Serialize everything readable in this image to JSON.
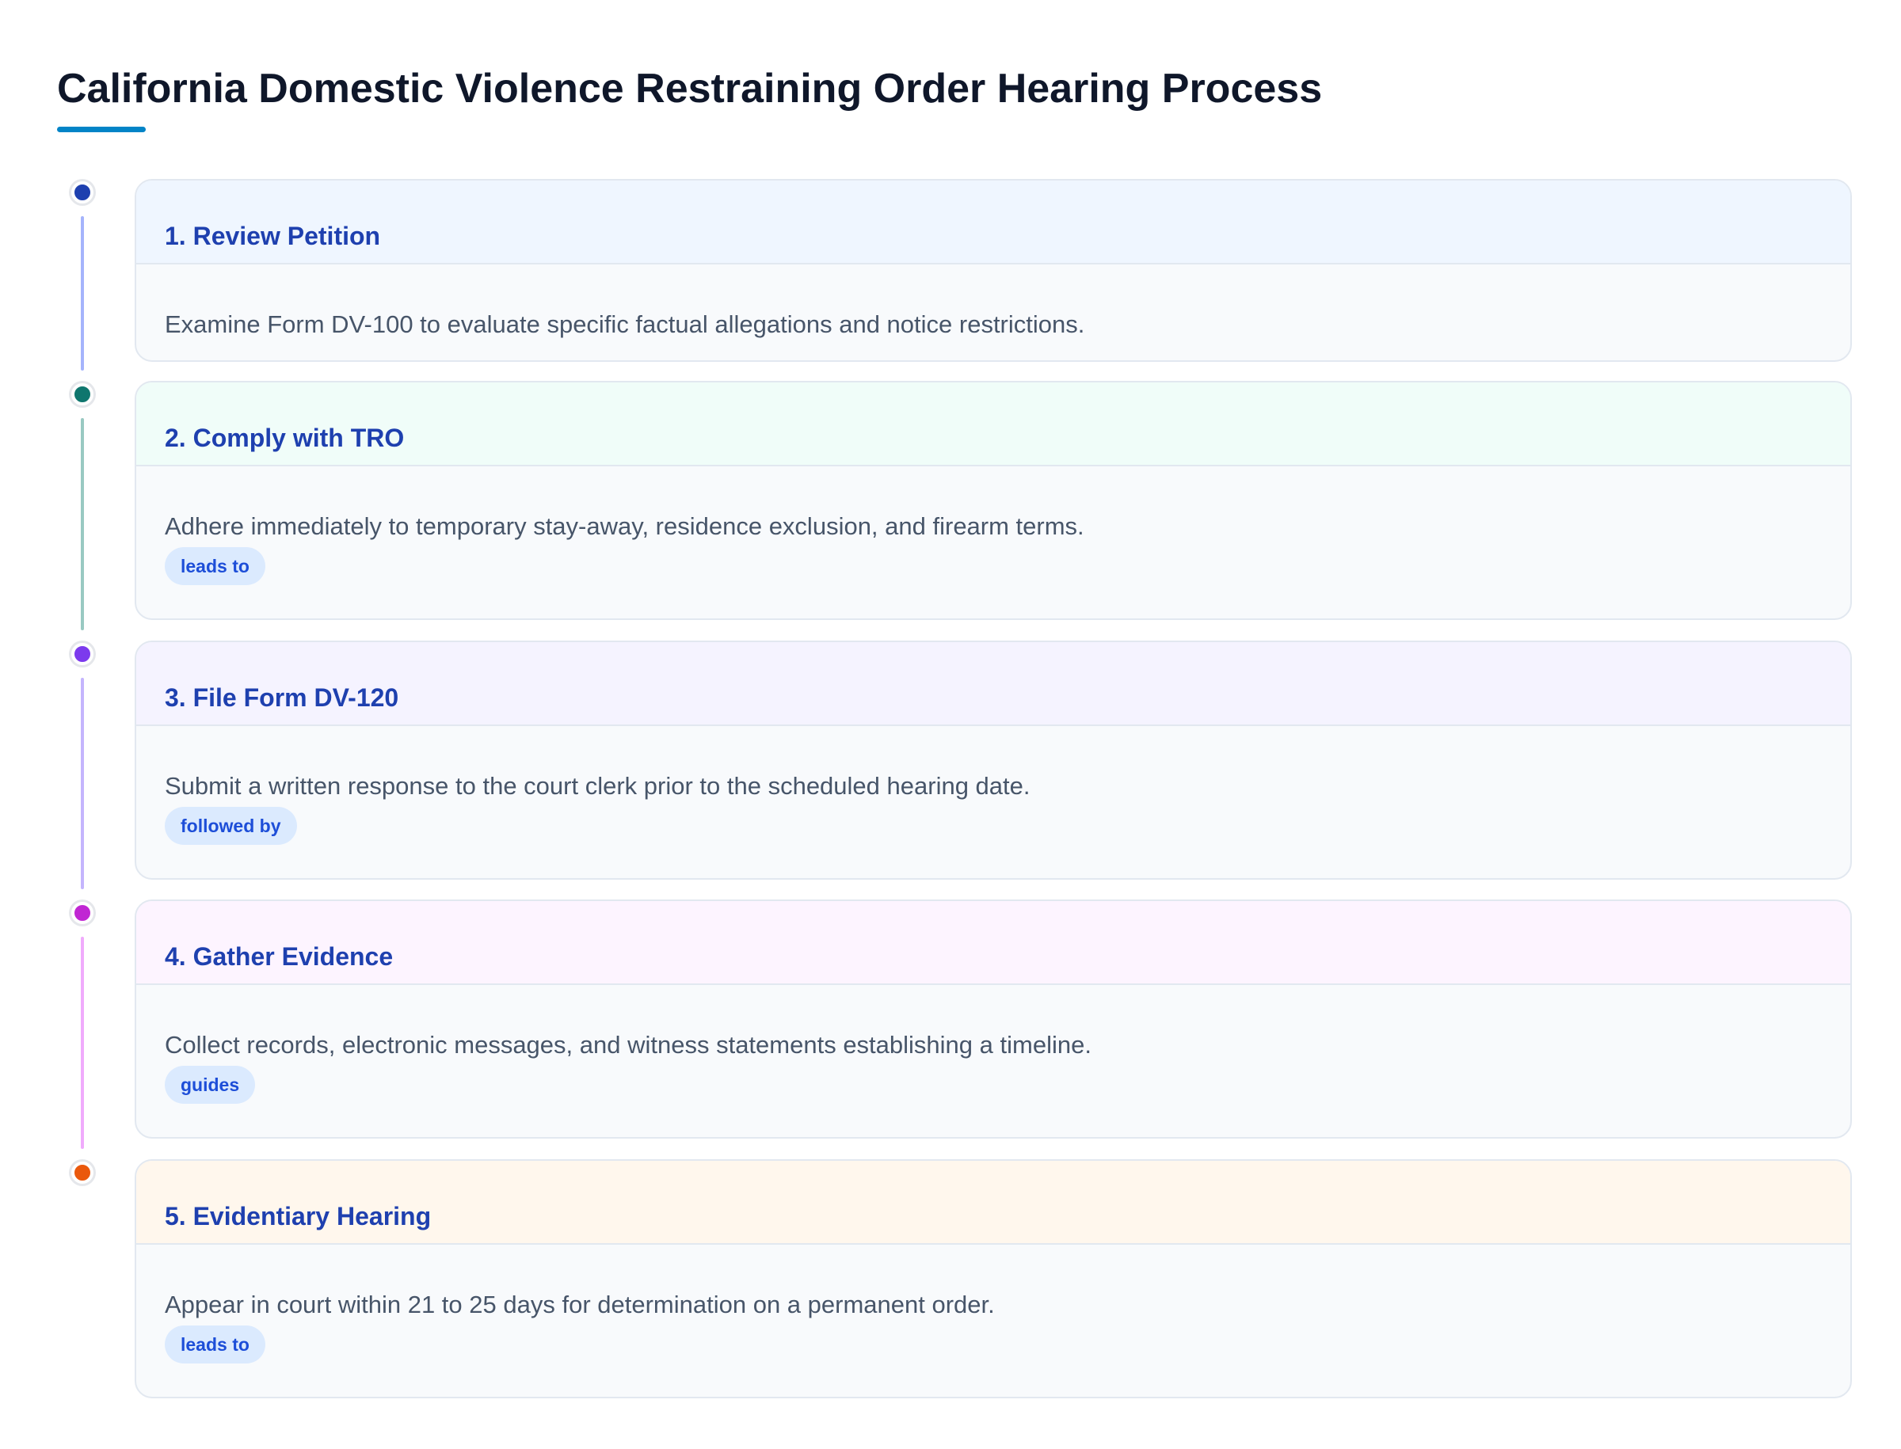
{
  "page": {
    "title": "California Domestic Violence Restraining Order Hearing Process"
  },
  "colors": {
    "title_underline": "#0284c7",
    "step_title": "#1e40af",
    "chip_bg": "#dbeafe",
    "chip_text": "#1d4ed8"
  },
  "steps": [
    {
      "title": "1. Review Petition",
      "description": "Examine Form DV-100 to evaluate specific factual allegations and notice restrictions.",
      "chip": "",
      "marker_color": "#1e40af",
      "connector_color": "#a5b4fc",
      "header_bg": "#eff6ff"
    },
    {
      "title": "2. Comply with TRO",
      "description": "Adhere immediately to temporary stay-away, residence exclusion, and firearm terms.",
      "chip": "leads to",
      "marker_color": "#0f766e",
      "connector_color": "#99c9c2",
      "header_bg": "#f0fdf9"
    },
    {
      "title": "3. File Form DV-120",
      "description": "Submit a written response to the court clerk prior to the scheduled hearing date.",
      "chip": "followed by",
      "marker_color": "#7c3aed",
      "connector_color": "#c4b5fd",
      "header_bg": "#f5f3ff"
    },
    {
      "title": "4. Gather Evidence",
      "description": "Collect records, electronic messages, and witness statements establishing a timeline.",
      "chip": "guides",
      "marker_color": "#c026d3",
      "connector_color": "#f0abfc",
      "header_bg": "#fdf4ff"
    },
    {
      "title": "5. Evidentiary Hearing",
      "description": "Appear in court within 21 to 25 days for determination on a permanent order.",
      "chip": "leads to",
      "marker_color": "#ea580c",
      "connector_color": "",
      "header_bg": "#fff7ed"
    }
  ]
}
